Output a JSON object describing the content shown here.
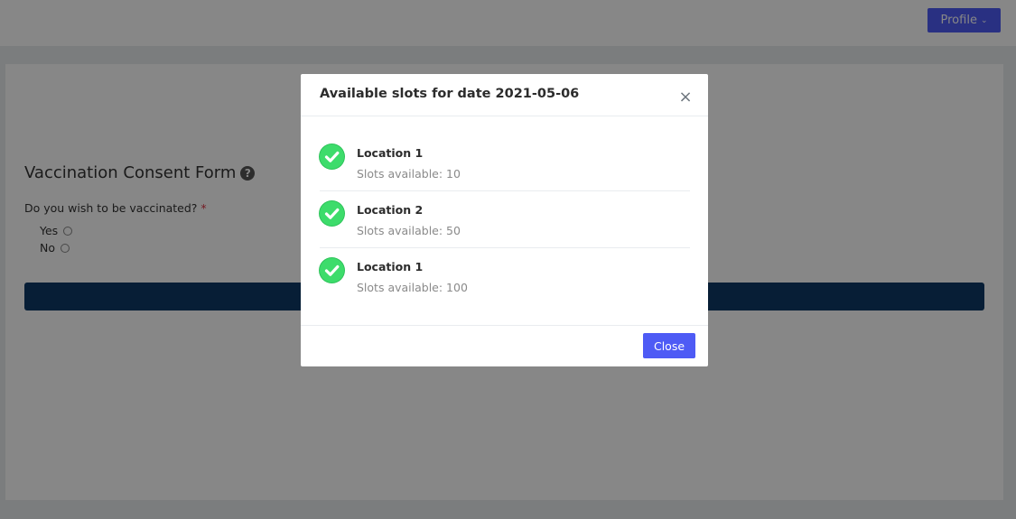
{
  "header": {
    "profile_label": "Profile",
    "profile_chevron": "⌄"
  },
  "form": {
    "title": "Vaccination Consent Form",
    "help_icon_glyph": "?",
    "question": "Do you wish to be vaccinated?",
    "required_marker": "*",
    "options": [
      {
        "label": "Yes",
        "selected": false
      },
      {
        "label": "No",
        "selected": false
      }
    ]
  },
  "modal": {
    "title": "Available slots for date 2021-05-06",
    "close_icon": "close-icon",
    "close_glyph": "×",
    "slots": [
      {
        "name": "Location 1",
        "availability": "Slots available: 10"
      },
      {
        "name": "Location 2",
        "availability": "Slots available: 50"
      },
      {
        "name": "Location 1",
        "availability": "Slots available: 100"
      }
    ],
    "close_button_label": "Close"
  },
  "colors": {
    "accent": "#4e5bf5",
    "submit_bar": "#0f3a66",
    "check_green": "#3ddc6b",
    "required_red": "#dc3545"
  }
}
